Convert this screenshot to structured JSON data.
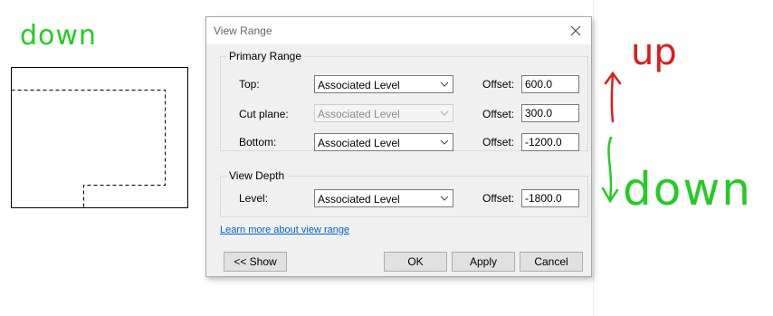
{
  "sketch": {
    "label": "down"
  },
  "annotations": {
    "up": "up",
    "down": "down"
  },
  "dialog": {
    "title": "View Range",
    "primary_range": {
      "legend": "Primary Range",
      "top": {
        "label": "Top:",
        "level": "Associated Level",
        "offset_label": "Offset:",
        "offset": "600.0"
      },
      "cut_plane": {
        "label": "Cut plane:",
        "level": "Associated Level",
        "offset_label": "Offset:",
        "offset": "300.0"
      },
      "bottom": {
        "label": "Bottom:",
        "level": "Associated Level",
        "offset_label": "Offset:",
        "offset": "-1200.0"
      }
    },
    "view_depth": {
      "legend": "View Depth",
      "level": {
        "label": "Level:",
        "level": "Associated Level",
        "offset_label": "Offset:",
        "offset": "-1800.0"
      }
    },
    "link": "Learn more about view range",
    "buttons": {
      "show": "<< Show",
      "ok": "OK",
      "apply": "Apply",
      "cancel": "Cancel"
    }
  },
  "colors": {
    "annotation_up": "#e01b1b",
    "annotation_down": "#22cc22",
    "sketch_label": "#22cc22",
    "link": "#0066cc"
  }
}
